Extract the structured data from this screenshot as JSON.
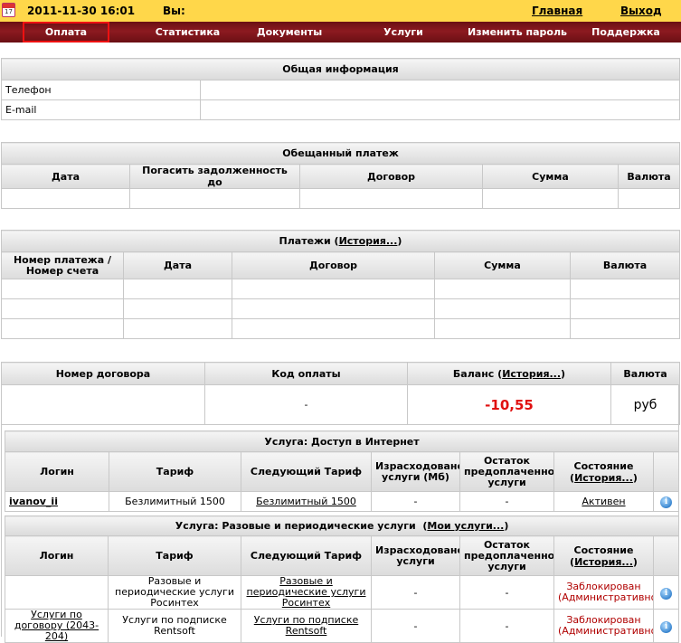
{
  "topbar": {
    "calendar_day": "17",
    "datetime": "2011-11-30 16:01",
    "user_label": "Вы:",
    "home_link": "Главная",
    "exit_link": "Выход"
  },
  "nav": {
    "items": [
      {
        "label": "Оплата"
      },
      {
        "label": "Статистика"
      },
      {
        "label": "Документы"
      },
      {
        "label": "Услуги"
      },
      {
        "label": "Изменить пароль"
      },
      {
        "label": "Поддержка"
      }
    ]
  },
  "general_info": {
    "title": "Общая информация",
    "rows": [
      {
        "label": "Телефон",
        "value": ""
      },
      {
        "label": "E-mail",
        "value": ""
      }
    ]
  },
  "promised_payment": {
    "title": "Обещанный платеж",
    "headers": [
      "Дата",
      "Погасить задолженность до",
      "Договор",
      "Сумма",
      "Валюта"
    ]
  },
  "payments": {
    "title": "Платежи",
    "history_link": "История...",
    "headers": [
      "Номер платежа / Номер счета",
      "Дата",
      "Договор",
      "Сумма",
      "Валюта"
    ]
  },
  "account": {
    "headers": {
      "contract": "Номер договора",
      "pay_code": "Код оплаты",
      "balance": "Баланс",
      "history_link": "История...",
      "currency": "Валюта"
    },
    "contract": "",
    "pay_code": "-",
    "balance": "-10,55",
    "currency": "руб"
  },
  "internet_service": {
    "title": "Услуга: Доступ в Интернет",
    "headers": [
      "Логин",
      "Тариф",
      "Следующий Тариф",
      "Израсходовано услуги (Мб)",
      "Остаток предоплаченной услуги",
      "Состояние",
      "История..."
    ],
    "row": {
      "login": "ivanov_ii",
      "tariff": "Безлимитный 1500",
      "next_tariff": "Безлимитный 1500",
      "used": "-",
      "remaining": "-",
      "state": "Активен"
    }
  },
  "periodic_service": {
    "title": "Услуга: Разовые и периодические услуги",
    "my_services_link": "Мои услуги...",
    "headers": [
      "Логин",
      "Тариф",
      "Следующий Тариф",
      "Израсходовано услуги",
      "Остаток предоплаченной услуги",
      "Состояние",
      "История..."
    ],
    "rows": [
      {
        "login": "",
        "tariff": "Разовые и периодические услуги Росинтех",
        "next_tariff": "Разовые и периодические услуги Росинтех",
        "used": "-",
        "remaining": "-",
        "state": "Заблокирован (Административно)"
      },
      {
        "login": "Услуги по договору (2043-204)",
        "tariff": "Услуги по подписке Rentsoft",
        "next_tariff": "Услуги по подписке Rentsoft",
        "used": "-",
        "remaining": "-",
        "state": "Заблокирован (Административно)"
      }
    ]
  }
}
